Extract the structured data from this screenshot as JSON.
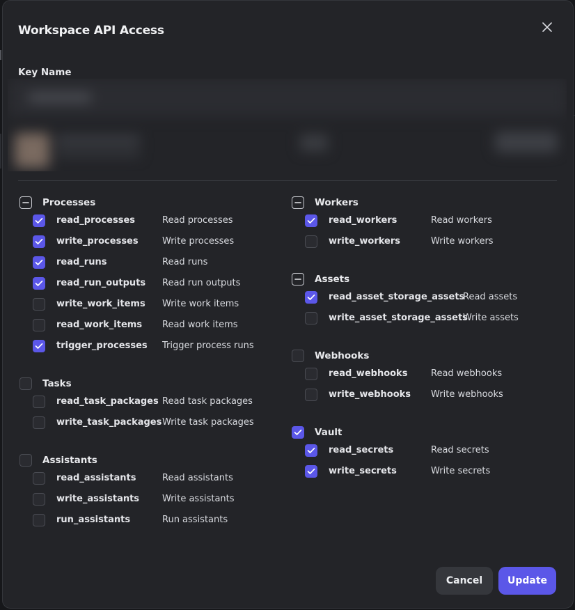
{
  "modal": {
    "title": "Workspace API Access",
    "close_icon": "close-icon",
    "key_name_label": "Key Name"
  },
  "groups_left": [
    {
      "label": "Processes",
      "state": "indeterminate",
      "scopes": [
        {
          "name": "read_processes",
          "desc": "Read processes",
          "checked": true
        },
        {
          "name": "write_processes",
          "desc": "Write processes",
          "checked": true
        },
        {
          "name": "read_runs",
          "desc": "Read runs",
          "checked": true
        },
        {
          "name": "read_run_outputs",
          "desc": "Read run outputs",
          "checked": true
        },
        {
          "name": "write_work_items",
          "desc": "Write work items",
          "checked": false
        },
        {
          "name": "read_work_items",
          "desc": "Read work items",
          "checked": false
        },
        {
          "name": "trigger_processes",
          "desc": "Trigger process runs",
          "checked": true
        }
      ]
    },
    {
      "label": "Tasks",
      "state": "unchecked",
      "scopes": [
        {
          "name": "read_task_packages",
          "desc": "Read task packages",
          "checked": false
        },
        {
          "name": "write_task_packages",
          "desc": "Write task packages",
          "checked": false
        }
      ]
    },
    {
      "label": "Assistants",
      "state": "unchecked",
      "scopes": [
        {
          "name": "read_assistants",
          "desc": "Read assistants",
          "checked": false
        },
        {
          "name": "write_assistants",
          "desc": "Write assistants",
          "checked": false
        },
        {
          "name": "run_assistants",
          "desc": "Run assistants",
          "checked": false
        }
      ]
    }
  ],
  "groups_right": [
    {
      "label": "Workers",
      "state": "indeterminate",
      "scopes": [
        {
          "name": "read_workers",
          "desc": "Read workers",
          "checked": true
        },
        {
          "name": "write_workers",
          "desc": "Write workers",
          "checked": false
        }
      ]
    },
    {
      "label": "Assets",
      "state": "indeterminate",
      "scopes": [
        {
          "name": "read_asset_storage_assets",
          "desc": "Read assets",
          "checked": true
        },
        {
          "name": "write_asset_storage_assets",
          "desc": "Write assets",
          "checked": false
        }
      ]
    },
    {
      "label": "Webhooks",
      "state": "unchecked",
      "scopes": [
        {
          "name": "read_webhooks",
          "desc": "Read webhooks",
          "checked": false
        },
        {
          "name": "write_webhooks",
          "desc": "Write webhooks",
          "checked": false
        }
      ]
    },
    {
      "label": "Vault",
      "state": "checked",
      "scopes": [
        {
          "name": "read_secrets",
          "desc": "Read secrets",
          "checked": true
        },
        {
          "name": "write_secrets",
          "desc": "Write secrets",
          "checked": true
        }
      ]
    }
  ],
  "footer": {
    "cancel_label": "Cancel",
    "update_label": "Update"
  },
  "colors": {
    "accent": "#5b57e8",
    "modal_bg": "#232428",
    "backdrop": "#16171a"
  }
}
